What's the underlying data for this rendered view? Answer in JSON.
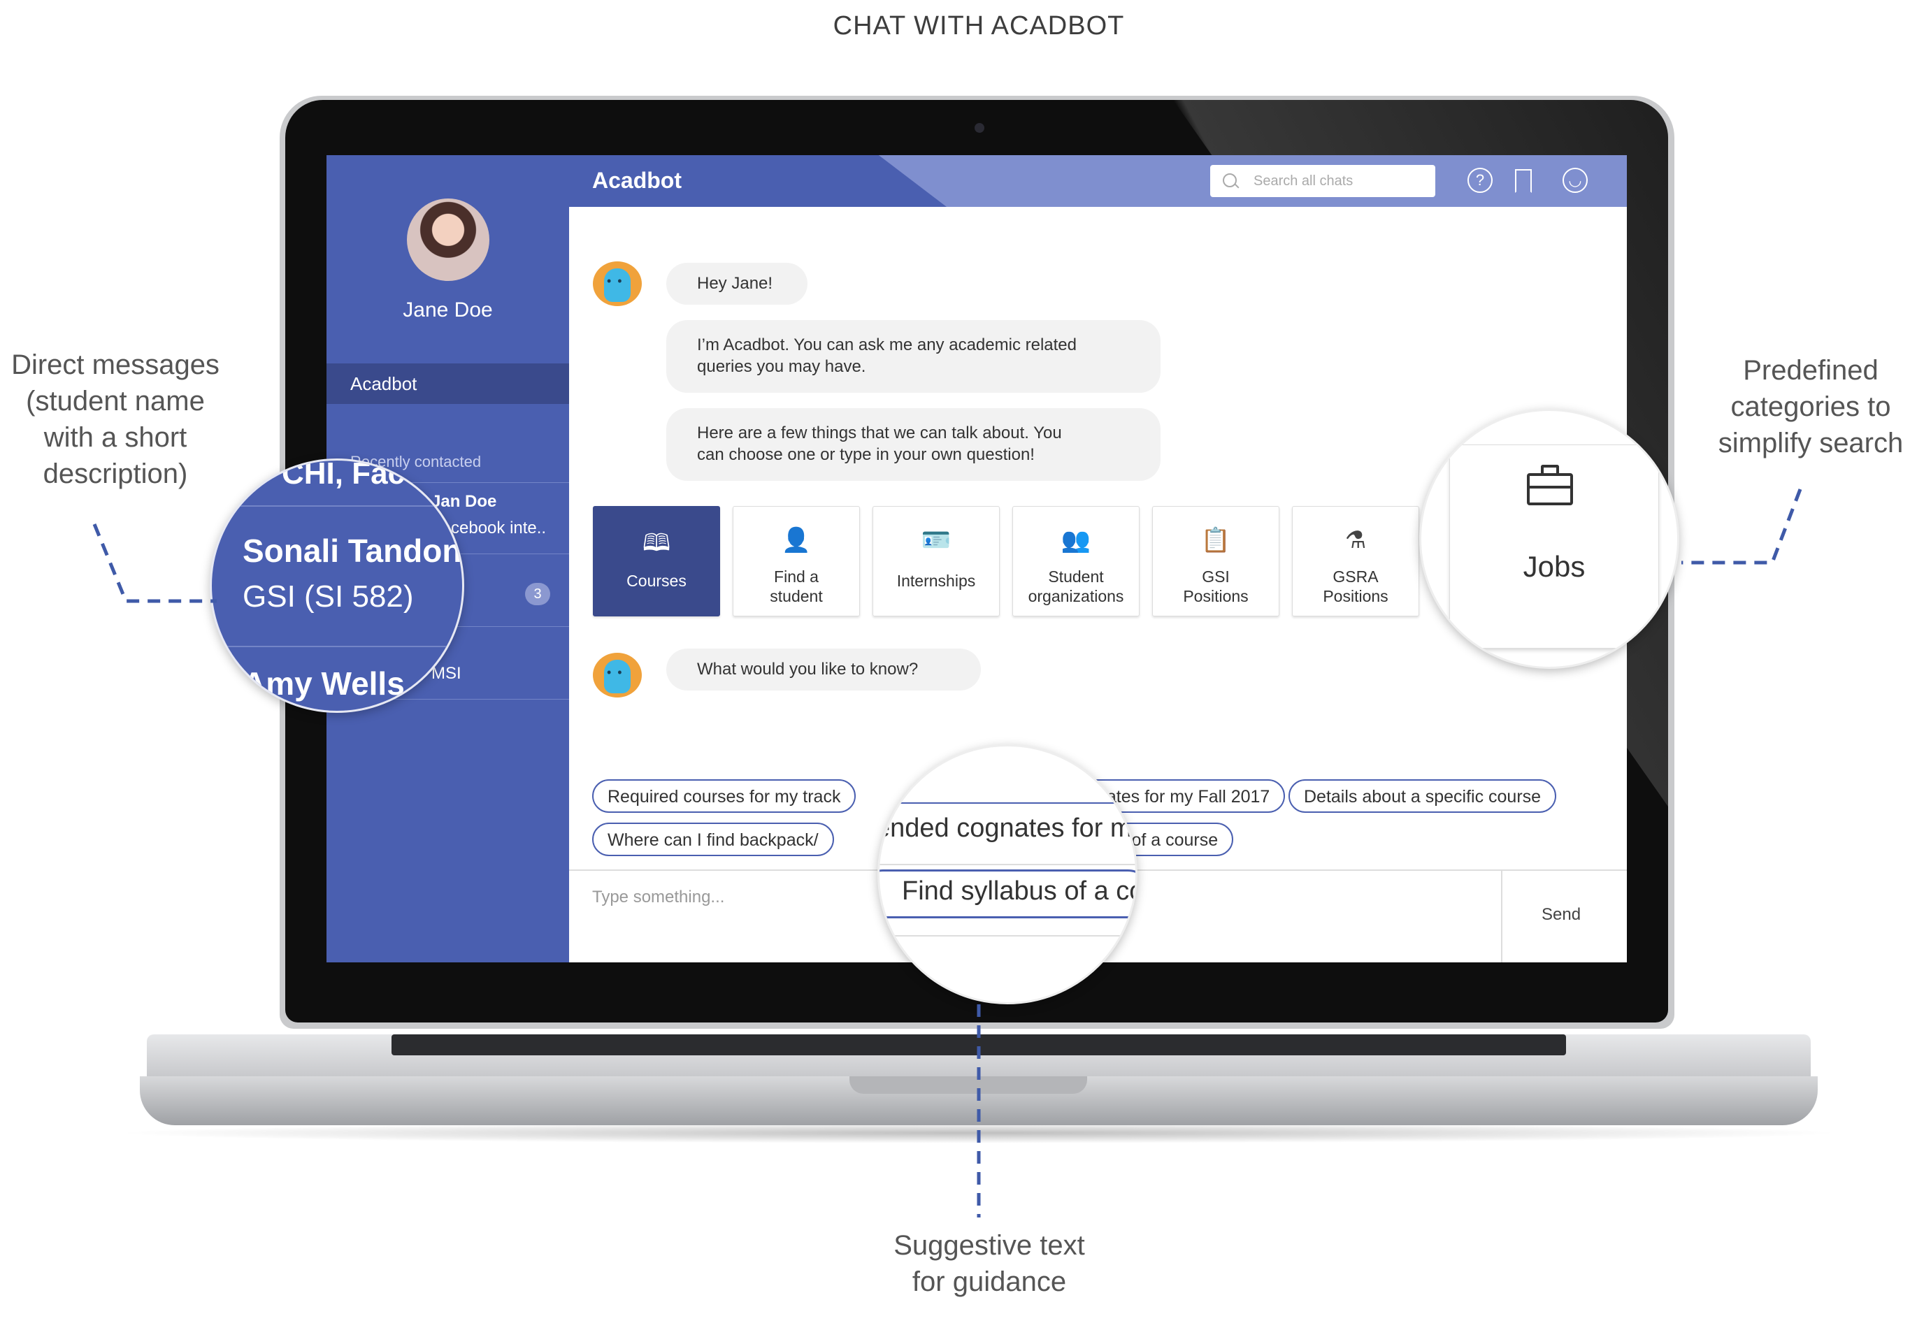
{
  "page": {
    "title": "CHAT WITH ACADBOT"
  },
  "annotations": {
    "left": [
      "Direct messages",
      "(student name",
      "with a short",
      "description)"
    ],
    "right": [
      "Predefined",
      "categories to",
      "simplify search"
    ],
    "bottom": [
      "Suggestive text",
      "for guidance"
    ]
  },
  "sidebar": {
    "user_name": "Jane Doe",
    "active_item": "Acadbot",
    "recent_label": "Recently contacted",
    "contacts": [
      {
        "name": "Jan Doe",
        "desc": "Facebook inte.."
      },
      {
        "name": "n",
        "desc": "",
        "badge": "3"
      },
      {
        "name": "",
        "desc": "MSI"
      }
    ]
  },
  "topbar": {
    "title": "Acadbot",
    "search_placeholder": "Search all chats"
  },
  "chat": {
    "messages": [
      "Hey Jane!",
      "I’m Acadbot. You can ask me any academic related",
      "queries you may have.",
      "Here are a few things that we can talk about. You",
      "can choose one or type in your own question!",
      "What would you like to know?"
    ],
    "categories": [
      {
        "label1": "Courses",
        "label2": "",
        "icon": "book-icon"
      },
      {
        "label1": "Find a",
        "label2": "student",
        "icon": "person-icon"
      },
      {
        "label1": "Internships",
        "label2": "",
        "icon": "id-badge-icon"
      },
      {
        "label1": "Student",
        "label2": "organizations",
        "icon": "group-icon"
      },
      {
        "label1": "GSI",
        "label2": "Positions",
        "icon": "presenter-icon"
      },
      {
        "label1": "GSRA",
        "label2": "Positions",
        "icon": "flask-icon"
      }
    ],
    "suggestions": [
      "Required courses for my track",
      "nates for my Fall 2017",
      "Details about a specific course",
      "Where can I find backpack/",
      "s of a course"
    ],
    "composer_placeholder": "Type something...",
    "send_label": "Send"
  },
  "magnifiers": {
    "left": {
      "top_text": "CHI, Face",
      "name": "Sonali Tandon",
      "desc": "GSI (SI 582)",
      "next_name": "Amy Wells"
    },
    "right": {
      "label": "Jobs",
      "icon": "briefcase-icon"
    },
    "bottom": {
      "top_text": "ended cognates for m",
      "chip": "Find syllabus of a cou"
    }
  },
  "colors": {
    "primary": "#4a5fb0",
    "dark": "#3a4a8c",
    "light": "#7f8fcf",
    "annotation_line": "#3f5aa8"
  }
}
